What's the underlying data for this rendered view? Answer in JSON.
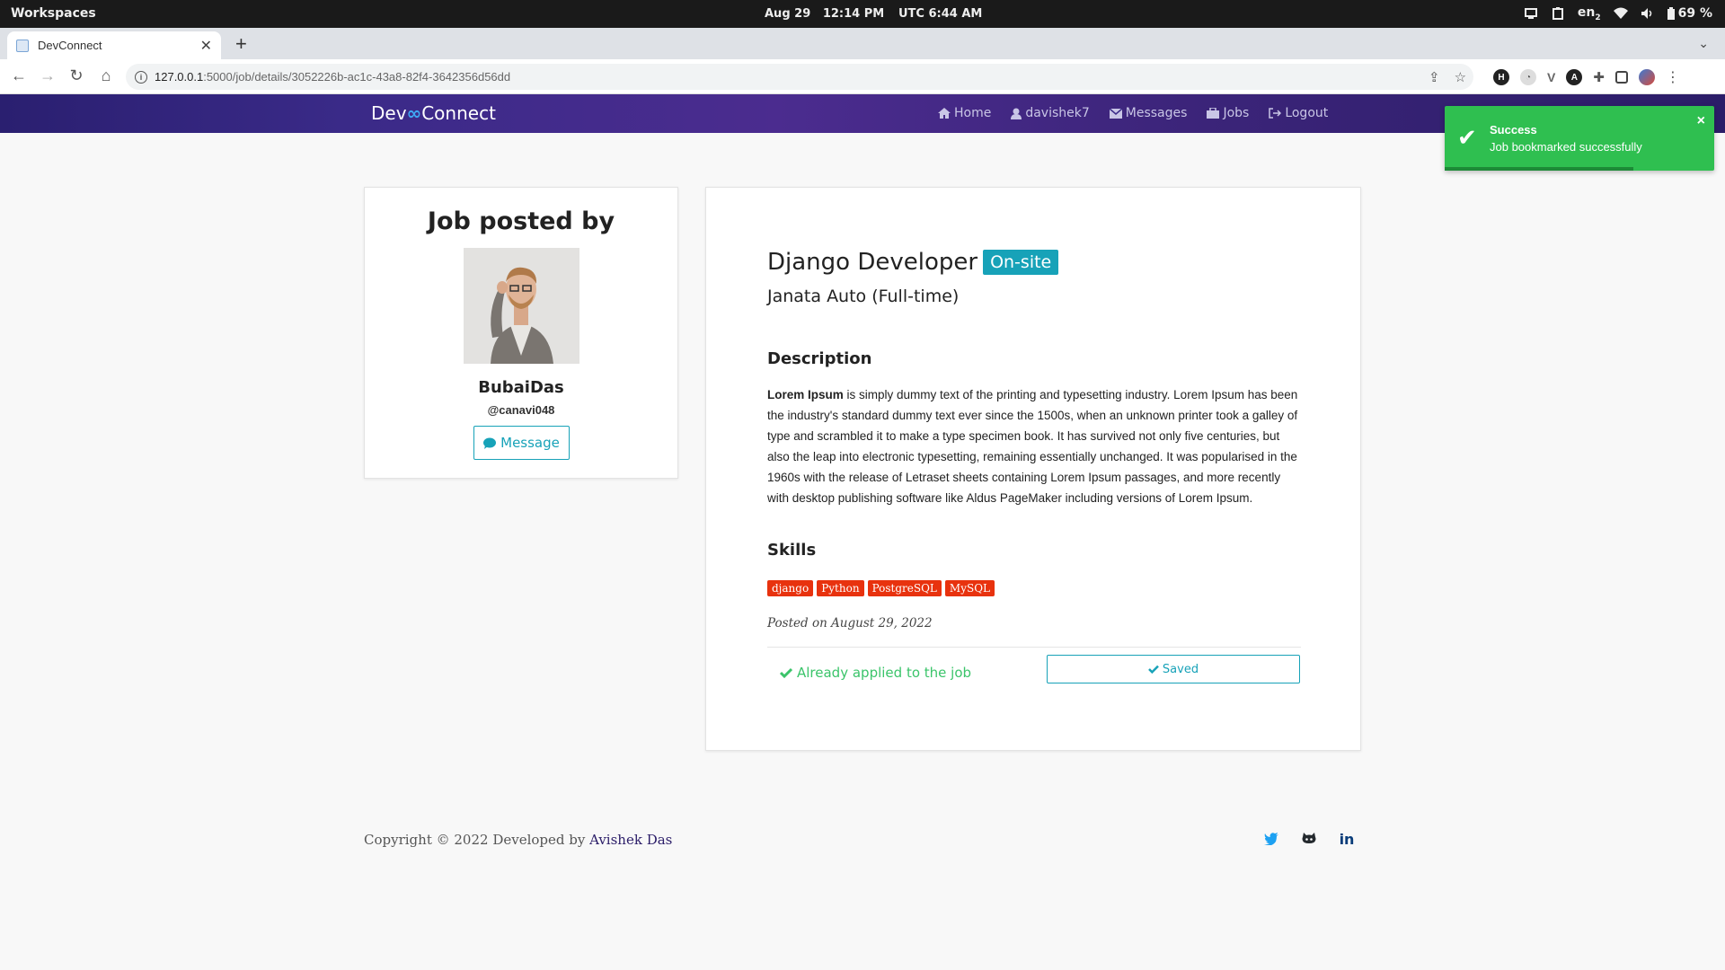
{
  "os": {
    "workspaces": "Workspaces",
    "date": "Aug 29",
    "time": "12:14 PM",
    "utc": "UTC  6:44 AM",
    "lang": "en",
    "lang_sub": "2",
    "battery": "69 %"
  },
  "browser": {
    "tab_title": "DevConnect",
    "url_host": "127.0.0.1",
    "url_path": ":5000/job/details/3052226b-ac1c-43a8-82f4-3642356d56dd"
  },
  "site": {
    "brand_left": "Dev",
    "brand_right": "Connect",
    "nav": {
      "home": "Home",
      "user": "davishek7",
      "messages": "Messages",
      "jobs": "Jobs",
      "logout": "Logout"
    }
  },
  "toast": {
    "title": "Success",
    "message": "Job bookmarked successfully",
    "progress_fraction": 0.7
  },
  "poster": {
    "heading": "Job posted by",
    "name": "BubaiDas",
    "handle": "@canavi048",
    "message_button": "Message"
  },
  "job": {
    "title": "Django Developer",
    "badge": "On-site",
    "company": "Janata Auto (Full-time)",
    "description_heading": "Description",
    "description_bold": "Lorem Ipsum",
    "description_text": " is simply dummy text of the printing and typesetting industry. Lorem Ipsum has been the industry's standard dummy text ever since the 1500s, when an unknown printer took a galley of type and scrambled it to make a type specimen book. It has survived not only five centuries, but also the leap into electronic typesetting, remaining essentially unchanged. It was popularised in the 1960s with the release of Letraset sheets containing Lorem Ipsum passages, and more recently with desktop publishing software like Aldus PageMaker including versions of Lorem Ipsum.",
    "skills_heading": "Skills",
    "skills": [
      "django",
      "Python",
      "PostgreSQL",
      "MySQL"
    ],
    "posted": "Posted on August 29, 2022",
    "applied_text": "Already applied to the job",
    "saved_button": "Saved"
  },
  "footer": {
    "copyright": "Copyright © 2022 Developed by ",
    "author": "Avishek Das"
  },
  "colors": {
    "accent": "#17a2b8",
    "skill": "#e8320e",
    "success": "#2fbf50",
    "applied": "#3bc46a"
  }
}
